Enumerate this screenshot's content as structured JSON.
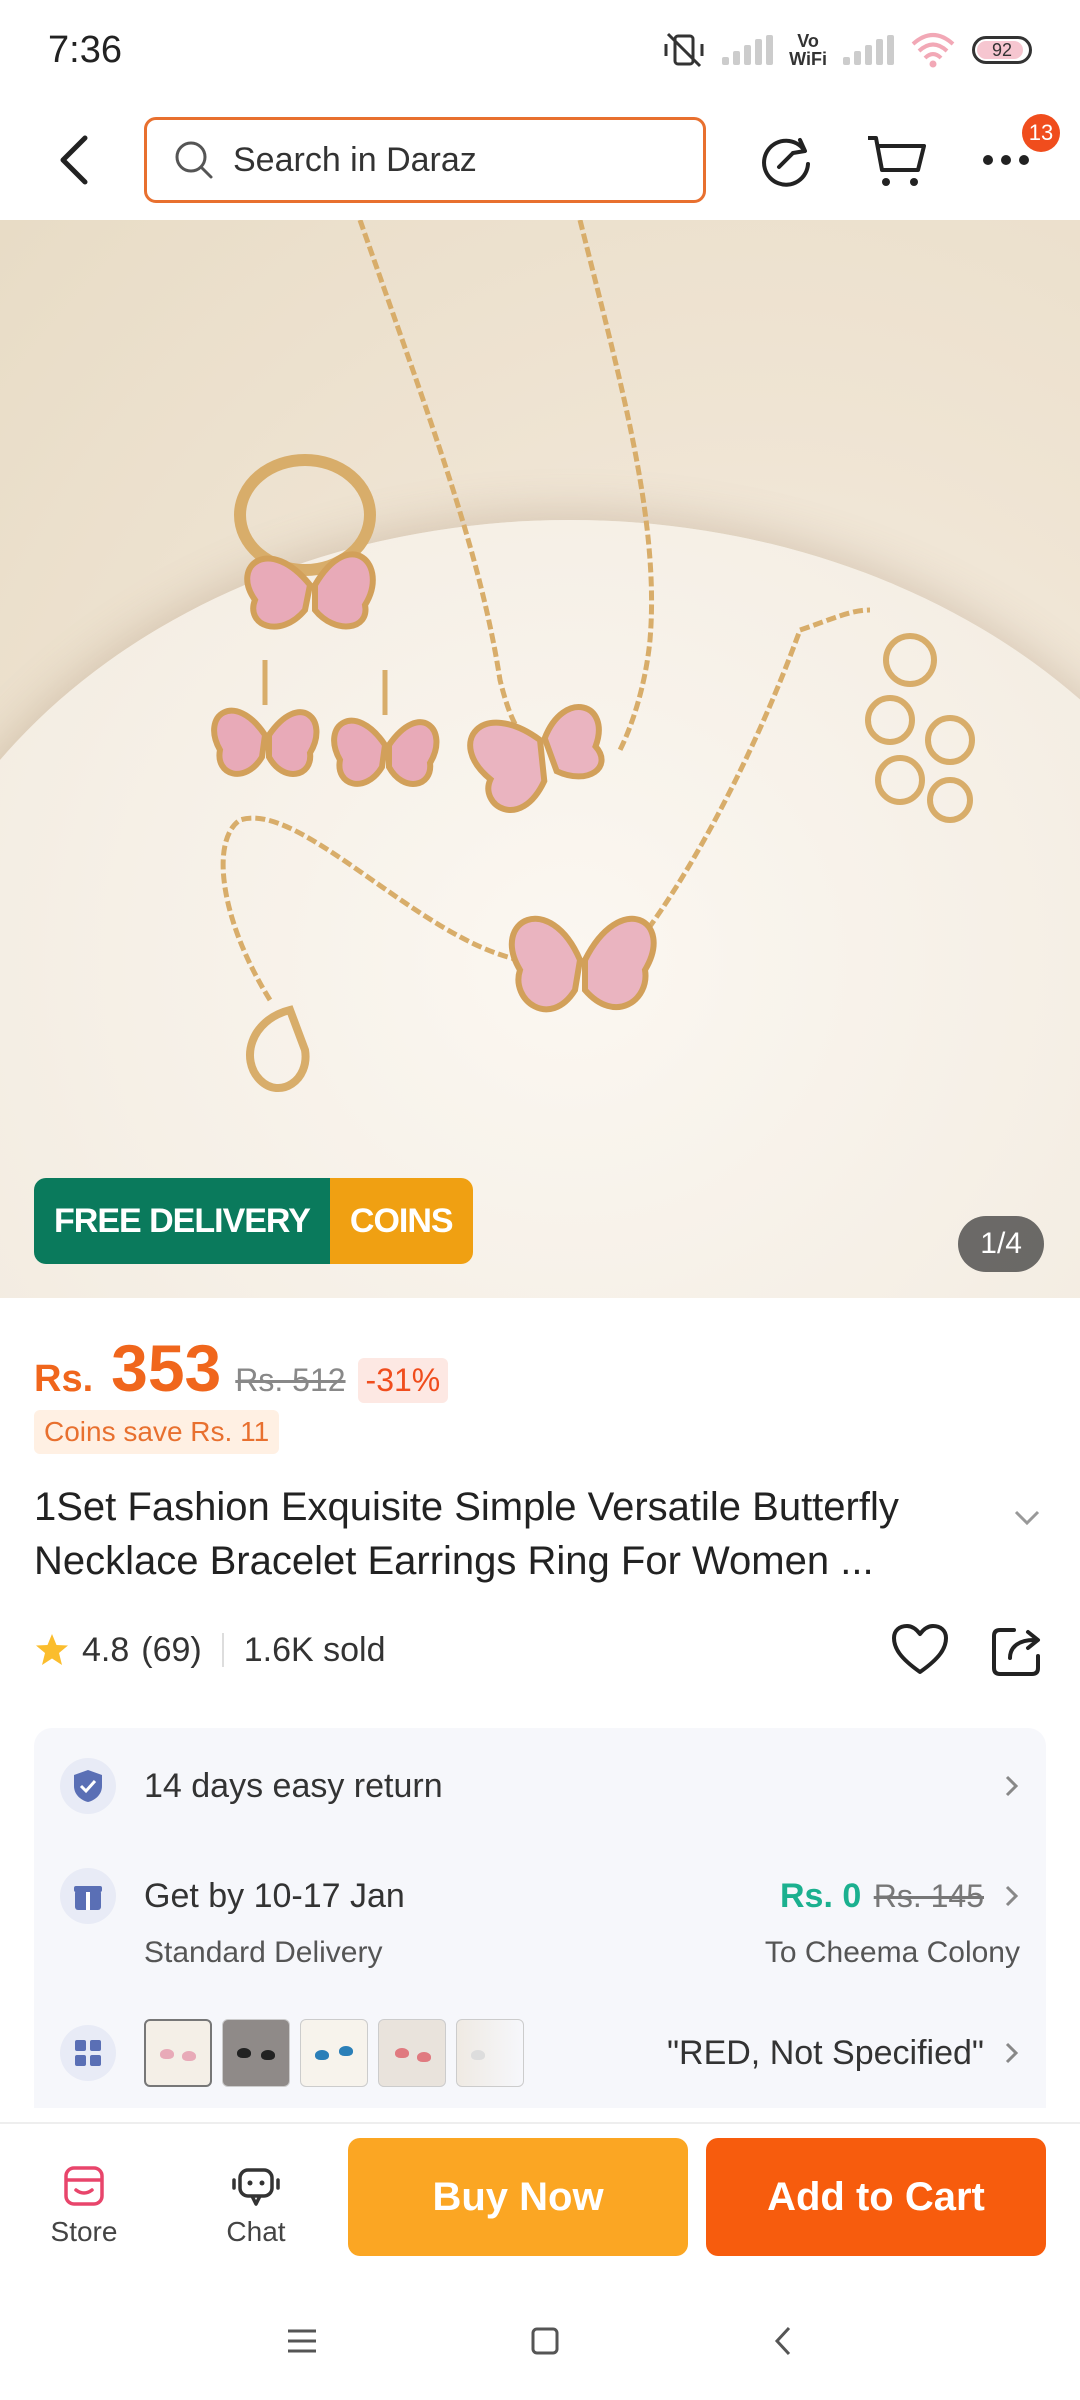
{
  "status_bar": {
    "time": "7:36",
    "vowifi_line1": "Vo",
    "vowifi_line2": "WiFi",
    "battery": "92",
    "battery_level": 0.92
  },
  "search": {
    "placeholder": "Search in Daraz"
  },
  "nav": {
    "badge_count": "13"
  },
  "gallery": {
    "tag_free": "FREE DELIVERY",
    "tag_coins": "COINS",
    "counter": "1/4"
  },
  "price": {
    "currency": "Rs.",
    "value": "353",
    "original": "Rs. 512",
    "discount": "-31%",
    "coins_save": "Coins save Rs. 11"
  },
  "product": {
    "title": "1Set Fashion Exquisite Simple Versatile Butterfly Necklace Bracelet Earrings Ring For Women ..."
  },
  "rating": {
    "score": "4.8",
    "count": "(69)",
    "sold": "1.6K sold"
  },
  "info": {
    "returns": "14 days easy return",
    "delivery_title": "Get by 10-17 Jan",
    "delivery_type": "Standard Delivery",
    "delivery_price": "Rs. 0",
    "delivery_old": "Rs. 145",
    "delivery_to": "To Cheema Colony",
    "variant": "\"RED, Not Specified\""
  },
  "actions": {
    "store": "Store",
    "chat": "Chat",
    "buy_now": "Buy Now",
    "add_to_cart": "Add to Cart"
  },
  "colors": {
    "accent": "#f75c0d",
    "buy_now": "#fba623",
    "free_delivery": "#0a7a5c",
    "coins": "#f0a012"
  }
}
